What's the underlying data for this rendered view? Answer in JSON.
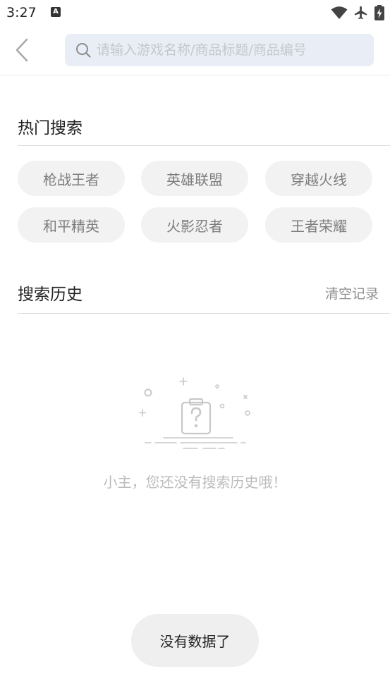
{
  "status_bar": {
    "time": "3:27",
    "notification_icon_letter": "A"
  },
  "search": {
    "placeholder": "请输入游戏名称/商品标题/商品编号",
    "value": ""
  },
  "hot_search": {
    "title": "热门搜索",
    "tags": [
      "枪战王者",
      "英雄联盟",
      "穿越火线",
      "和平精英",
      "火影忍者",
      "王者荣耀"
    ]
  },
  "history": {
    "title": "搜索历史",
    "clear_label": "清空记录",
    "empty_text": "小主，您还没有搜索历史哦！"
  },
  "toast": {
    "text": "没有数据了"
  },
  "colors": {
    "search_bg": "#e9eef6",
    "tag_bg": "#f2f2f2",
    "muted_text": "#8f8f8f"
  }
}
